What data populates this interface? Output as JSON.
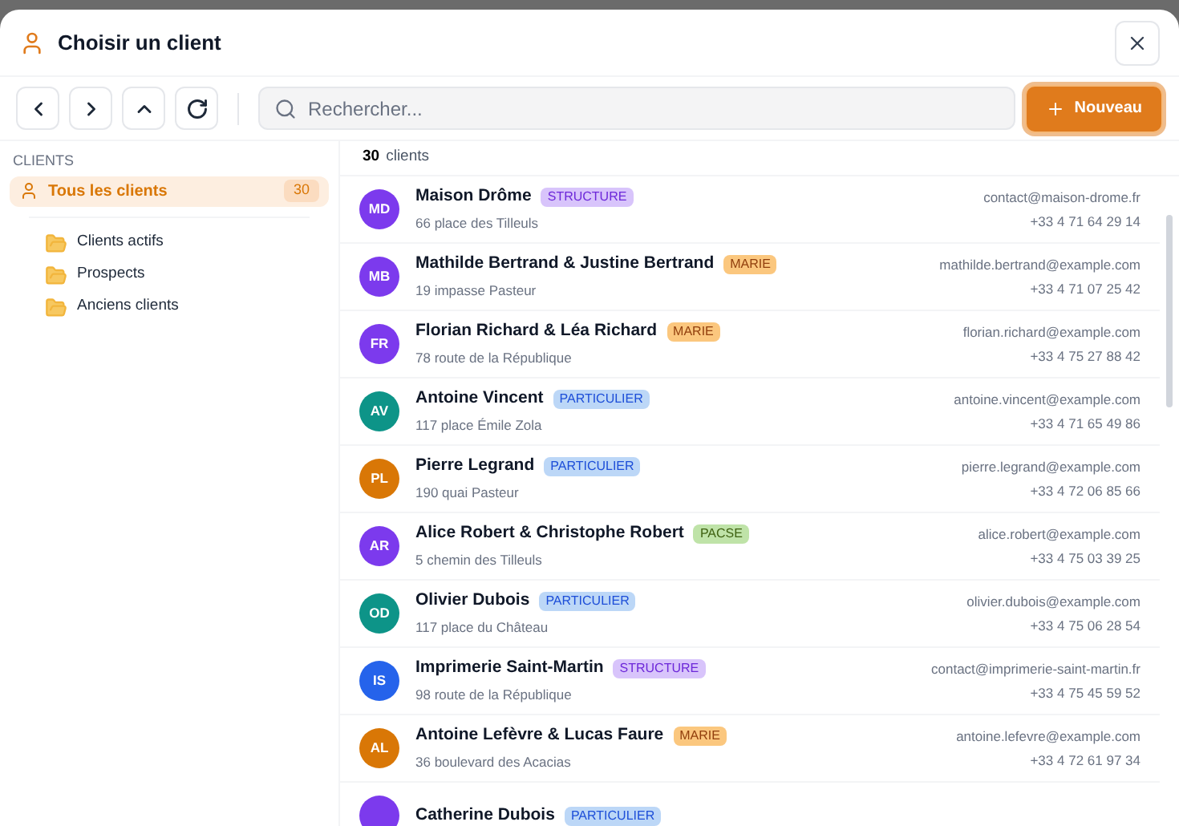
{
  "dialog": {
    "title": "Choisir un client"
  },
  "toolbar": {
    "search": {
      "placeholder": "Rechercher..."
    },
    "new_button": "Nouveau"
  },
  "sidebar": {
    "heading": "CLIENTS",
    "all": {
      "label": "Tous les clients",
      "count": "30",
      "selected": true
    },
    "folders": [
      {
        "label": "Clients actifs",
        "selected": false
      },
      {
        "label": "Prospects",
        "selected": false
      },
      {
        "label": "Anciens clients",
        "selected": false
      }
    ]
  },
  "list": {
    "count": "30",
    "count_label": "clients",
    "rows": [
      {
        "initials": "MD",
        "color": "#7c3aed",
        "name": "Maison Drôme",
        "tag": "STRUCTURE",
        "kind": "structure",
        "address": "66 place des Tilleuls",
        "email": "contact@maison-drome.fr",
        "phone": "+33 4 71 64 29 14"
      },
      {
        "initials": "MB",
        "color": "#7c3aed",
        "name": "Mathilde Bertrand & Justine Bertrand",
        "tag": "MARIE",
        "kind": "marie",
        "address": "19 impasse Pasteur",
        "email": "mathilde.bertrand@example.com",
        "phone": "+33 4 71 07 25 42"
      },
      {
        "initials": "FR",
        "color": "#7c3aed",
        "name": "Florian Richard & Léa Richard",
        "tag": "MARIE",
        "kind": "marie",
        "address": "78 route de la République",
        "email": "florian.richard@example.com",
        "phone": "+33 4 75 27 88 42"
      },
      {
        "initials": "AV",
        "color": "#0d9488",
        "name": "Antoine Vincent",
        "tag": "PARTICULIER",
        "kind": "particulier",
        "address": "117 place Émile Zola",
        "email": "antoine.vincent@example.com",
        "phone": "+33 4 71 65 49 86"
      },
      {
        "initials": "PL",
        "color": "#d97706",
        "name": "Pierre Legrand",
        "tag": "PARTICULIER",
        "kind": "particulier",
        "address": "190 quai Pasteur",
        "email": "pierre.legrand@example.com",
        "phone": "+33 4 72 06 85 66"
      },
      {
        "initials": "AR",
        "color": "#7c3aed",
        "name": "Alice Robert & Christophe Robert",
        "tag": "PACSE",
        "kind": "pacse",
        "address": "5 chemin des Tilleuls",
        "email": "alice.robert@example.com",
        "phone": "+33 4 75 03 39 25"
      },
      {
        "initials": "OD",
        "color": "#0d9488",
        "name": "Olivier Dubois",
        "tag": "PARTICULIER",
        "kind": "particulier",
        "address": "117 place du Château",
        "email": "olivier.dubois@example.com",
        "phone": "+33 4 75 06 28 54"
      },
      {
        "initials": "IS",
        "color": "#2563eb",
        "name": "Imprimerie Saint-Martin",
        "tag": "STRUCTURE",
        "kind": "structure",
        "address": "98 route de la République",
        "email": "contact@imprimerie-saint-martin.fr",
        "phone": "+33 4 75 45 59 52"
      },
      {
        "initials": "AL",
        "color": "#d97706",
        "name": "Antoine Lefèvre & Lucas Faure",
        "tag": "MARIE",
        "kind": "marie",
        "address": "36 boulevard des Acacias",
        "email": "antoine.lefevre@example.com",
        "phone": "+33 4 72 61 97 34"
      },
      {
        "color": "#7c3aed",
        "name": "Catherine Dubois",
        "tag": "PARTICULIER",
        "kind": "particulier"
      }
    ]
  }
}
